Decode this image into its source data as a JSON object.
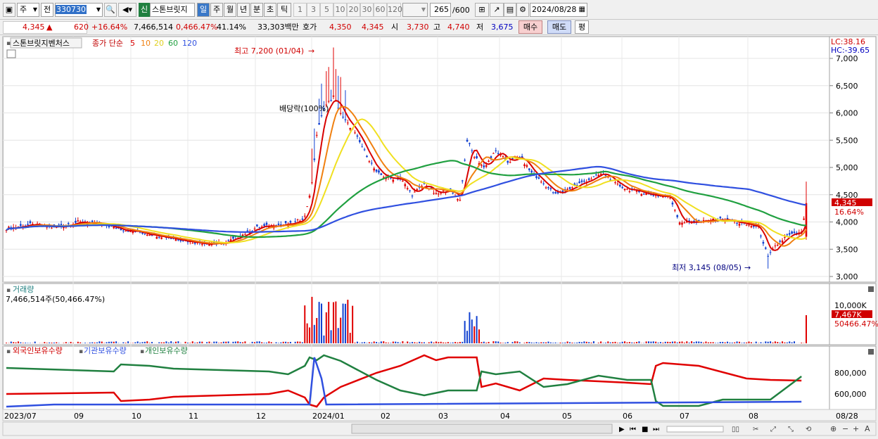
{
  "toolbar": {
    "period_main": "주",
    "prev": "전",
    "code": "330730",
    "stock_tag": "신",
    "stock_name": "스톤브릿지",
    "periods": [
      "일",
      "주",
      "월",
      "년",
      "분",
      "초",
      "틱"
    ],
    "active_period": "일",
    "minutes": [
      "1",
      "3",
      "5",
      "10",
      "20",
      "30",
      "60",
      "120"
    ],
    "count": "265",
    "count_max": "/600",
    "date": "2024/08/28"
  },
  "quote": {
    "price": "4,345",
    "arrow": "▲",
    "change": "620",
    "rate": "+16.64%",
    "volume": "7,466,514",
    "vol_ratio": "0,466.47%",
    "turnover": "41.14%",
    "value": "33,303백만",
    "bid_label": "호가",
    "bid1": "4,350",
    "bid2": "4,345",
    "open_label": "시",
    "open": "3,730",
    "high_label": "고",
    "high": "4,740",
    "low_label": "저",
    "low": "3,675",
    "buy": "매수",
    "sell": "매도",
    "eval": "평"
  },
  "price_panel": {
    "title": "스톤브릿지벤처스",
    "ma_label": "종가 단순",
    "ma": [
      "5",
      "10",
      "20",
      "60",
      "120"
    ],
    "ma_colors": [
      "#d80000",
      "#f08010",
      "#f0e020",
      "#20a040",
      "#3050e0"
    ],
    "lc": "LC:38.16",
    "hc": "HC:-39.65",
    "high_note": "최고 7,200 (01/04)",
    "low_note": "최저 3,145 (08/05)",
    "event_note": "배당락(100%)",
    "last_price": "4,345",
    "last_rate": "16.64%",
    "yticks": [
      "7,000",
      "6,500",
      "6,000",
      "5,500",
      "5,000",
      "4,500",
      "4,000",
      "3,500",
      "3,000"
    ]
  },
  "volume_panel": {
    "title": "거래량",
    "summary": "7,466,514주(50,466.47%)",
    "ytick": "10,000K",
    "last": "7,467K",
    "last_rate": "50466.47%"
  },
  "holding_panel": {
    "labels": [
      "외국인보유수량",
      "기관보유수량",
      "개인보유수량"
    ],
    "yticks": [
      "800,000",
      "600,000"
    ]
  },
  "xaxis": {
    "labels": [
      "2023/07",
      "09",
      "10",
      "11",
      "12",
      "2024/01",
      "02",
      "03",
      "04",
      "05",
      "06",
      "07",
      "08",
      "08/28"
    ]
  },
  "chart_data": {
    "type": "candlestick",
    "x_range": [
      "2023/07",
      "2024/08/28"
    ],
    "ylim": [
      3000,
      7200
    ],
    "y_ticks": [
      7000,
      6500,
      6000,
      5500,
      5000,
      4500,
      4000,
      3500,
      3000
    ],
    "high": 7200,
    "high_date": "01/04",
    "low": 3145,
    "low_date": "08/05",
    "last_close": 4345,
    "last_change_pct": 16.64,
    "moving_averages": [
      5,
      10,
      20,
      60,
      120
    ],
    "volume_last_k": 7467,
    "volume_tick_k": 10000
  }
}
